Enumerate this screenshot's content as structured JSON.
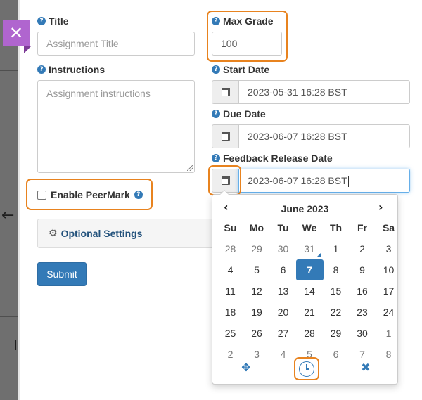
{
  "form": {
    "title_label": "Title",
    "title_placeholder": "Assignment Title",
    "instructions_label": "Instructions",
    "instructions_placeholder": "Assignment instructions",
    "peermark_label": "Enable PeerMark",
    "optional_settings_label": "Optional Settings",
    "submit_label": "Submit",
    "max_grade_label": "Max Grade",
    "max_grade_value": "100",
    "start_date_label": "Start Date",
    "start_date_value": "2023-05-31 16:28 BST",
    "due_date_label": "Due Date",
    "due_date_value": "2023-06-07 16:28 BST",
    "feedback_date_label": "Feedback Release Date",
    "feedback_date_value": "2023-06-07 16:28 BST"
  },
  "datepicker": {
    "month_label": "June 2023",
    "prev_icon": "chevron-left-icon",
    "next_icon": "chevron-right-icon",
    "weekdays": [
      "Su",
      "Mo",
      "Tu",
      "We",
      "Th",
      "Fr",
      "Sa"
    ],
    "weeks": [
      [
        "28",
        "29",
        "30",
        "31",
        "1",
        "2",
        "3"
      ],
      [
        "4",
        "5",
        "6",
        "7",
        "8",
        "9",
        "10"
      ],
      [
        "11",
        "12",
        "13",
        "14",
        "15",
        "16",
        "17"
      ],
      [
        "18",
        "19",
        "20",
        "21",
        "22",
        "23",
        "24"
      ],
      [
        "25",
        "26",
        "27",
        "28",
        "29",
        "30",
        "1"
      ],
      [
        "2",
        "3",
        "4",
        "5",
        "6",
        "7",
        "8"
      ]
    ],
    "selected_day": "7",
    "footer_icons": [
      "move-icon",
      "clock-icon",
      "close-icon"
    ]
  },
  "colors": {
    "accent": "#337ab7",
    "highlight": "#e8831f",
    "close_flag": "#b065cf"
  }
}
